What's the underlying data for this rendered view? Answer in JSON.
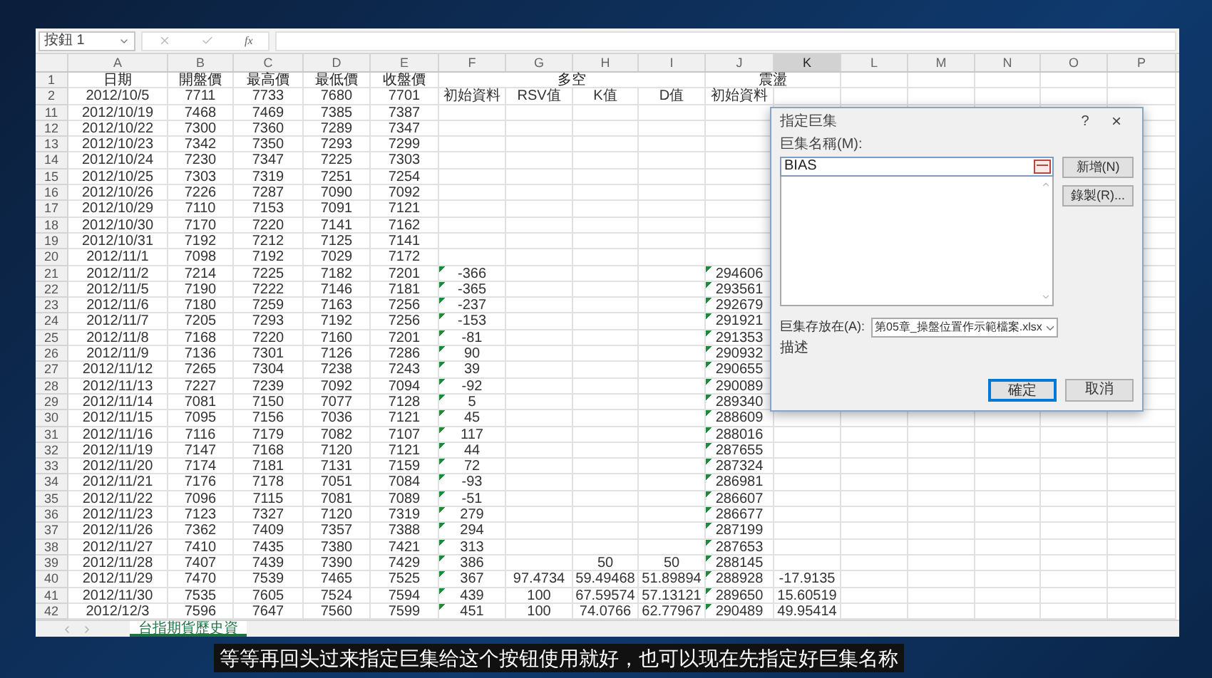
{
  "name_box": "按鈕 1",
  "function_label": "fx",
  "columns": [
    {
      "label": "A",
      "selected": false
    },
    {
      "label": "B",
      "selected": false
    },
    {
      "label": "C",
      "selected": false
    },
    {
      "label": "D",
      "selected": false
    },
    {
      "label": "E",
      "selected": false
    },
    {
      "label": "F",
      "selected": false
    },
    {
      "label": "G",
      "selected": false
    },
    {
      "label": "H",
      "selected": false
    },
    {
      "label": "I",
      "selected": false
    },
    {
      "label": "J",
      "selected": false
    },
    {
      "label": "K",
      "selected": true
    },
    {
      "label": "L",
      "selected": false
    },
    {
      "label": "M",
      "selected": false
    },
    {
      "label": "N",
      "selected": false
    },
    {
      "label": "O",
      "selected": false
    },
    {
      "label": "P",
      "selected": false
    }
  ],
  "header_row": {
    "num": "1",
    "cells": [
      "日期",
      "開盤價",
      "最高價",
      "最低價",
      "收盤價"
    ],
    "groups": [
      {
        "label": "多空"
      },
      {
        "label": "震盪"
      }
    ]
  },
  "rows": [
    {
      "num": "2",
      "flags": false,
      "cells": {
        "A": "2012/10/5",
        "B": "7711",
        "C": "7733",
        "D": "7680",
        "E": "7701",
        "F": "初始資料",
        "G": "RSV值",
        "H": "K值",
        "I": "D值",
        "J": "初始資料"
      }
    },
    {
      "num": "11",
      "flags": false,
      "cells": {
        "A": "2012/10/19",
        "B": "7468",
        "C": "7469",
        "D": "7385",
        "E": "7387"
      }
    },
    {
      "num": "12",
      "flags": false,
      "cells": {
        "A": "2012/10/22",
        "B": "7300",
        "C": "7360",
        "D": "7289",
        "E": "7347"
      }
    },
    {
      "num": "13",
      "flags": false,
      "cells": {
        "A": "2012/10/23",
        "B": "7342",
        "C": "7350",
        "D": "7293",
        "E": "7299"
      }
    },
    {
      "num": "14",
      "flags": false,
      "cells": {
        "A": "2012/10/24",
        "B": "7230",
        "C": "7347",
        "D": "7225",
        "E": "7303"
      }
    },
    {
      "num": "15",
      "flags": false,
      "cells": {
        "A": "2012/10/25",
        "B": "7303",
        "C": "7319",
        "D": "7251",
        "E": "7254"
      }
    },
    {
      "num": "16",
      "flags": false,
      "cells": {
        "A": "2012/10/26",
        "B": "7226",
        "C": "7287",
        "D": "7090",
        "E": "7092"
      }
    },
    {
      "num": "17",
      "flags": false,
      "cells": {
        "A": "2012/10/29",
        "B": "7110",
        "C": "7153",
        "D": "7091",
        "E": "7121"
      }
    },
    {
      "num": "18",
      "flags": false,
      "cells": {
        "A": "2012/10/30",
        "B": "7170",
        "C": "7220",
        "D": "7141",
        "E": "7162"
      }
    },
    {
      "num": "19",
      "flags": false,
      "cells": {
        "A": "2012/10/31",
        "B": "7192",
        "C": "7212",
        "D": "7125",
        "E": "7141"
      }
    },
    {
      "num": "20",
      "flags": false,
      "cells": {
        "A": "2012/11/1",
        "B": "7098",
        "C": "7192",
        "D": "7029",
        "E": "7172"
      }
    },
    {
      "num": "21",
      "flags": true,
      "cells": {
        "A": "2012/11/2",
        "B": "7214",
        "C": "7225",
        "D": "7182",
        "E": "7201",
        "F": "-366",
        "J": "294606"
      }
    },
    {
      "num": "22",
      "flags": true,
      "cells": {
        "A": "2012/11/5",
        "B": "7190",
        "C": "7222",
        "D": "7146",
        "E": "7181",
        "F": "-365",
        "J": "293561"
      }
    },
    {
      "num": "23",
      "flags": true,
      "cells": {
        "A": "2012/11/6",
        "B": "7180",
        "C": "7259",
        "D": "7163",
        "E": "7256",
        "F": "-237",
        "J": "292679"
      }
    },
    {
      "num": "24",
      "flags": true,
      "cells": {
        "A": "2012/11/7",
        "B": "7205",
        "C": "7293",
        "D": "7192",
        "E": "7256",
        "F": "-153",
        "J": "291921"
      }
    },
    {
      "num": "25",
      "flags": true,
      "cells": {
        "A": "2012/11/8",
        "B": "7168",
        "C": "7220",
        "D": "7160",
        "E": "7201",
        "F": "-81",
        "J": "291353"
      }
    },
    {
      "num": "26",
      "flags": true,
      "cells": {
        "A": "2012/11/9",
        "B": "7136",
        "C": "7301",
        "D": "7126",
        "E": "7286",
        "F": "90",
        "J": "290932"
      }
    },
    {
      "num": "27",
      "flags": true,
      "cells": {
        "A": "2012/11/12",
        "B": "7265",
        "C": "7304",
        "D": "7238",
        "E": "7243",
        "F": "39",
        "J": "290655"
      }
    },
    {
      "num": "28",
      "flags": true,
      "cells": {
        "A": "2012/11/13",
        "B": "7227",
        "C": "7239",
        "D": "7092",
        "E": "7094",
        "F": "-92",
        "J": "290089"
      }
    },
    {
      "num": "29",
      "flags": true,
      "cells": {
        "A": "2012/11/14",
        "B": "7081",
        "C": "7150",
        "D": "7077",
        "E": "7128",
        "F": "5",
        "J": "289340"
      }
    },
    {
      "num": "30",
      "flags": true,
      "cells": {
        "A": "2012/11/15",
        "B": "7095",
        "C": "7156",
        "D": "7036",
        "E": "7121",
        "F": "45",
        "J": "288609"
      }
    },
    {
      "num": "31",
      "flags": true,
      "cells": {
        "A": "2012/11/16",
        "B": "7116",
        "C": "7179",
        "D": "7082",
        "E": "7107",
        "F": "117",
        "J": "288016"
      }
    },
    {
      "num": "32",
      "flags": true,
      "cells": {
        "A": "2012/11/19",
        "B": "7147",
        "C": "7168",
        "D": "7120",
        "E": "7121",
        "F": "44",
        "J": "287655"
      }
    },
    {
      "num": "33",
      "flags": true,
      "cells": {
        "A": "2012/11/20",
        "B": "7174",
        "C": "7181",
        "D": "7131",
        "E": "7159",
        "F": "72",
        "J": "287324"
      }
    },
    {
      "num": "34",
      "flags": true,
      "cells": {
        "A": "2012/11/21",
        "B": "7176",
        "C": "7178",
        "D": "7051",
        "E": "7084",
        "F": "-93",
        "J": "286981"
      }
    },
    {
      "num": "35",
      "flags": true,
      "cells": {
        "A": "2012/11/22",
        "B": "7096",
        "C": "7115",
        "D": "7081",
        "E": "7089",
        "F": "-51",
        "J": "286607"
      }
    },
    {
      "num": "36",
      "flags": true,
      "cells": {
        "A": "2012/11/23",
        "B": "7123",
        "C": "7327",
        "D": "7120",
        "E": "7319",
        "F": "279",
        "J": "286677"
      }
    },
    {
      "num": "37",
      "flags": true,
      "cells": {
        "A": "2012/11/26",
        "B": "7362",
        "C": "7409",
        "D": "7357",
        "E": "7388",
        "F": "294",
        "J": "287199"
      }
    },
    {
      "num": "38",
      "flags": true,
      "cells": {
        "A": "2012/11/27",
        "B": "7410",
        "C": "7435",
        "D": "7380",
        "E": "7421",
        "F": "313",
        "J": "287653"
      }
    },
    {
      "num": "39",
      "flags": true,
      "cells": {
        "A": "2012/11/28",
        "B": "7407",
        "C": "7439",
        "D": "7390",
        "E": "7429",
        "F": "386",
        "H": "50",
        "I": "50",
        "J": "288145"
      }
    },
    {
      "num": "40",
      "flags": true,
      "cells": {
        "A": "2012/11/29",
        "B": "7470",
        "C": "7539",
        "D": "7465",
        "E": "7525",
        "F": "367",
        "G": "97.4734",
        "H": "59.49468",
        "I": "51.89894",
        "J": "288928",
        "K": "-17.9135"
      }
    },
    {
      "num": "41",
      "flags": true,
      "cells": {
        "A": "2012/11/30",
        "B": "7535",
        "C": "7605",
        "D": "7524",
        "E": "7594",
        "F": "439",
        "G": "100",
        "H": "67.59574",
        "I": "57.13121",
        "J": "289650",
        "K": "15.60519"
      }
    },
    {
      "num": "42",
      "flags": true,
      "cells": {
        "A": "2012/12/3",
        "B": "7596",
        "C": "7647",
        "D": "7560",
        "E": "7599",
        "F": "451",
        "G": "100",
        "H": "74.0766",
        "I": "62.77967",
        "J": "290489",
        "K": "49.95414"
      }
    }
  ],
  "sheet_tab": "台指期貨歷史資",
  "dialog": {
    "title": "指定巨集",
    "help": "?",
    "close": "×",
    "name_label": "巨集名稱(M):",
    "name_value": "BIAS",
    "side_buttons": [
      "新增(N)",
      "錄製(R)..."
    ],
    "store_label": "巨集存放在(A):",
    "store_value": "第05章_操盤位置作示範檔案.xlsx",
    "description_label": "描述",
    "footer_buttons": [
      {
        "label": "確定",
        "focused": true
      },
      {
        "label": "取消",
        "focused": false
      }
    ]
  },
  "subtitle": "等等再回头过来指定巨集给这个按钮使用就好，也可以现在先指定好巨集名称"
}
